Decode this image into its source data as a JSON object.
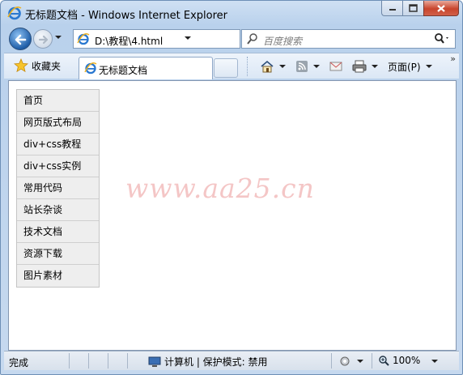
{
  "window": {
    "title": "无标题文档 - Windows Internet Explorer",
    "caption_buttons": {
      "minimize": "minimize-icon",
      "maximize": "maximize-icon",
      "close": "close-icon"
    }
  },
  "navigation": {
    "address": "D:\\教程\\4.html",
    "search_placeholder": "百度搜索"
  },
  "favorites": {
    "label": "收藏夹"
  },
  "tabs": [
    {
      "label": "无标题文档"
    }
  ],
  "command_bar": {
    "page_label": "页面(P)"
  },
  "page": {
    "menu": [
      {
        "label": "首页"
      },
      {
        "label": "网页版式布局"
      },
      {
        "label": "div+css教程"
      },
      {
        "label": "div+css实例"
      },
      {
        "label": "常用代码"
      },
      {
        "label": "站长杂谈"
      },
      {
        "label": "技术文档"
      },
      {
        "label": "资源下载"
      },
      {
        "label": "图片素材"
      }
    ],
    "watermark": "www.aa25.cn"
  },
  "status_bar": {
    "status": "完成",
    "zone": "计算机 | 保护模式: 禁用",
    "zoom": "100%"
  },
  "colors": {
    "menu_background": "#eeeeee",
    "watermark": "#f4c6c6",
    "close_button": "#c8452c"
  }
}
